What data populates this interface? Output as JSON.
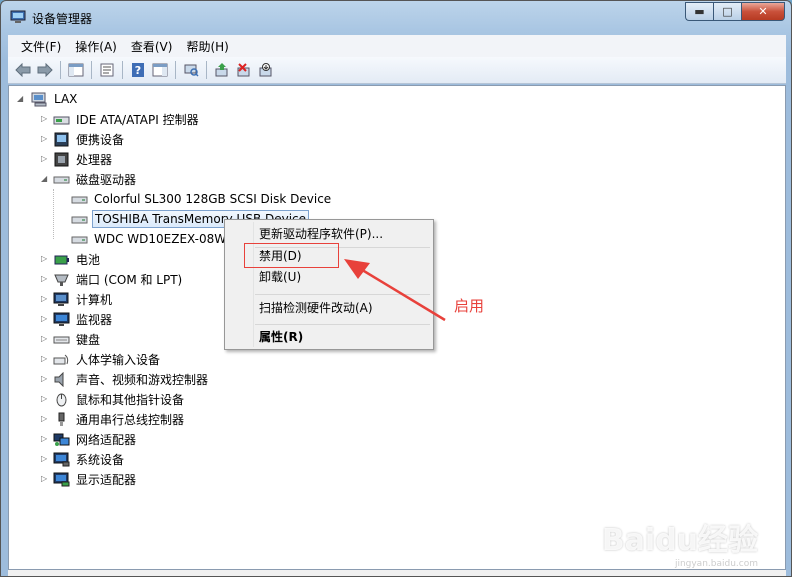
{
  "window": {
    "title": "设备管理器",
    "min_glyph": "▬",
    "max_glyph": "□",
    "close_glyph": "✕"
  },
  "menubar": {
    "items": [
      "文件(F)",
      "操作(A)",
      "查看(V)",
      "帮助(H)"
    ]
  },
  "toolbar": {
    "icons": [
      "back-arrow-icon",
      "forward-arrow-icon",
      "show-hide-tree-icon",
      "properties-icon",
      "help-icon",
      "show-action-pane-icon",
      "scan-hardware-icon",
      "update-driver-icon",
      "uninstall-icon",
      "disable-icon"
    ]
  },
  "tree": {
    "root": "LAX",
    "nodes": [
      {
        "label": "IDE ATA/ATAPI 控制器",
        "icon": "ide-controller-icon",
        "expanded": false
      },
      {
        "label": "便携设备",
        "icon": "portable-device-icon",
        "expanded": false
      },
      {
        "label": "处理器",
        "icon": "processor-icon",
        "expanded": false
      },
      {
        "label": "磁盘驱动器",
        "icon": "disk-drive-icon",
        "expanded": true
      },
      {
        "label": "电池",
        "icon": "battery-icon",
        "expanded": false
      },
      {
        "label": "端口 (COM 和 LPT)",
        "icon": "port-icon",
        "expanded": false
      },
      {
        "label": "计算机",
        "icon": "computer-icon",
        "expanded": false
      },
      {
        "label": "监视器",
        "icon": "monitor-icon",
        "expanded": false
      },
      {
        "label": "键盘",
        "icon": "keyboard-icon",
        "expanded": false
      },
      {
        "label": "人体学输入设备",
        "icon": "hid-icon",
        "expanded": false
      },
      {
        "label": "声音、视频和游戏控制器",
        "icon": "sound-icon",
        "expanded": false
      },
      {
        "label": "鼠标和其他指针设备",
        "icon": "mouse-icon",
        "expanded": false
      },
      {
        "label": "通用串行总线控制器",
        "icon": "usb-icon",
        "expanded": false
      },
      {
        "label": "网络适配器",
        "icon": "network-icon",
        "expanded": false
      },
      {
        "label": "系统设备",
        "icon": "system-device-icon",
        "expanded": false
      },
      {
        "label": "显示适配器",
        "icon": "display-adapter-icon",
        "expanded": false
      }
    ],
    "disk_children": [
      "Colorful SL300 128GB SCSI Disk Device",
      "TOSHIBA TransMemory USB Device",
      "WDC WD10EZEX-08WN"
    ]
  },
  "context_menu": {
    "update_driver": "更新驱动程序软件(P)...",
    "disable": "禁用(D)",
    "uninstall": "卸载(U)",
    "scan": "扫描检测硬件改动(A)",
    "properties": "属性(R)"
  },
  "annotation": {
    "text": "启用",
    "color": "#e8413b"
  },
  "watermark": {
    "brand": "Bai",
    "glyph": "du",
    "suffix": "经验",
    "url": "jingyan.baidu.com"
  }
}
